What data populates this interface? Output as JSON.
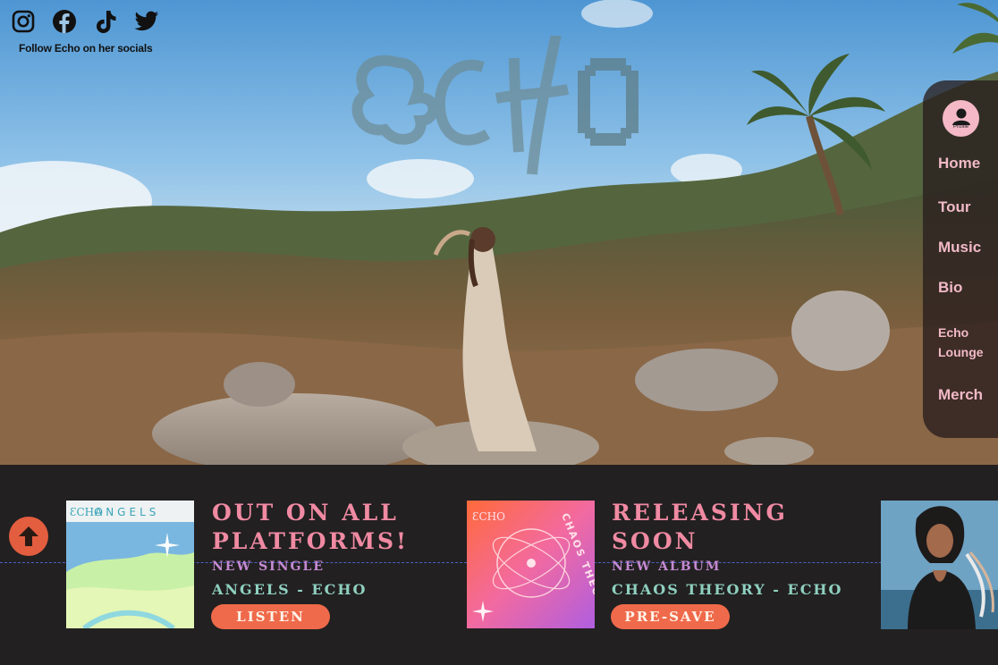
{
  "socials": {
    "icons": [
      "instagram-icon",
      "facebook-icon",
      "tiktok-icon",
      "twitter-icon"
    ],
    "caption": "Follow Echo on her socials"
  },
  "logo": {
    "text": "ECHO"
  },
  "nav": {
    "profile_label": "Profile",
    "items": [
      "Home",
      "Tour",
      "Music",
      "Bio",
      "Echo Lounge",
      "Merch"
    ]
  },
  "releases": [
    {
      "heading": "Out on all platforms!",
      "kind": "New single",
      "title": "Angels - Echo",
      "button": "Listen",
      "cover_text": "ANGELS"
    },
    {
      "heading": "Releasing soon",
      "kind": "New album",
      "title": "Chaos Theory - Echo",
      "button": "Pre-save",
      "cover_text": "CHAOS THEORY"
    }
  ],
  "colors": {
    "accent_pink": "#f08aa3",
    "accent_purple": "#c48ad2",
    "accent_teal": "#8fd0bf",
    "button_orange": "#ef6a4b",
    "background": "#222021"
  }
}
